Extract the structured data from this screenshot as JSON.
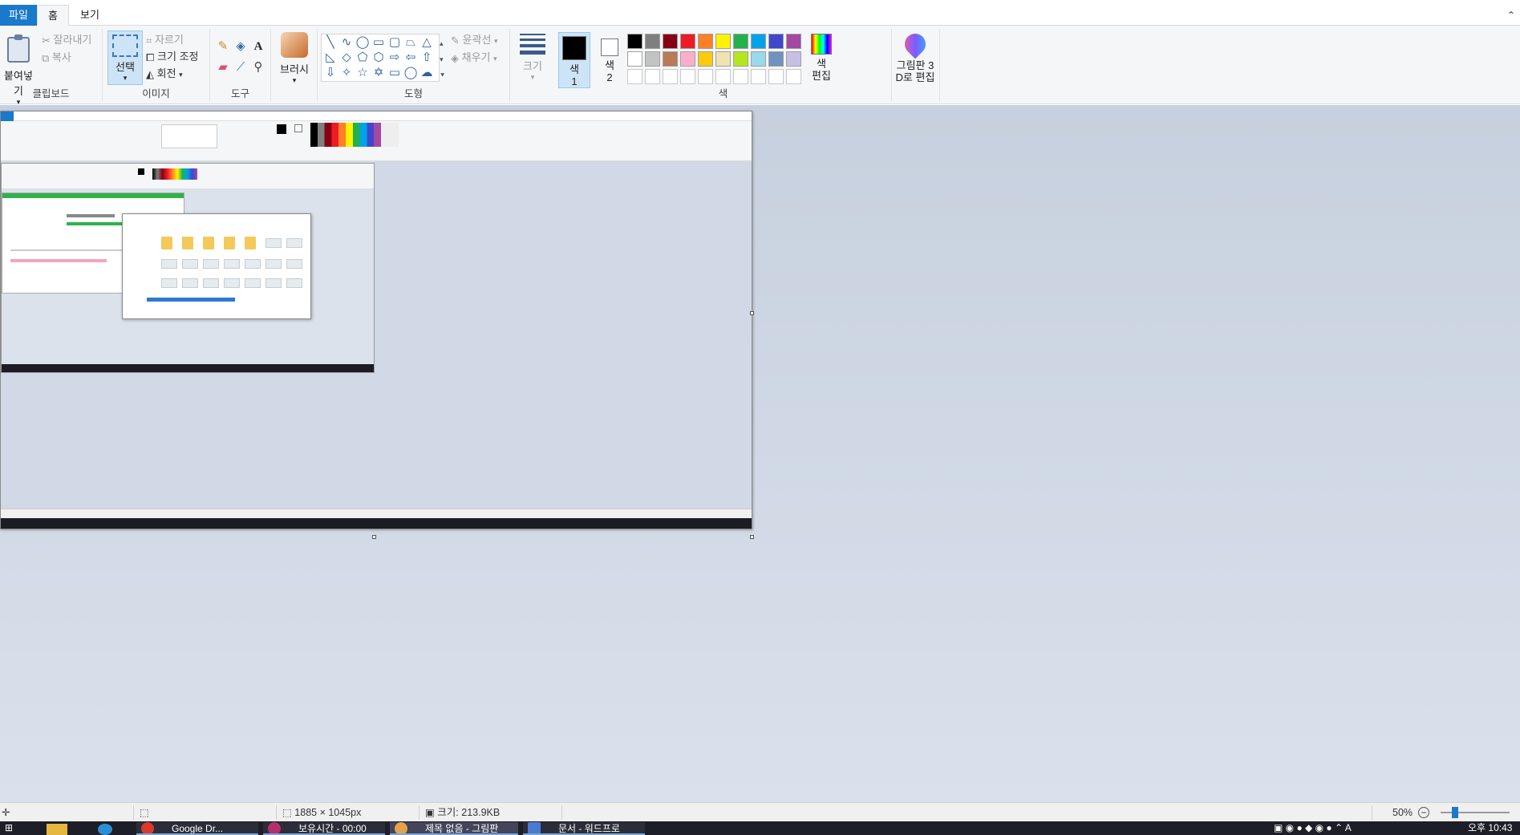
{
  "menu": {
    "tabs": [
      "파일",
      "홈",
      "보기"
    ]
  },
  "ribbon": {
    "clipboard": {
      "label": "클립보드",
      "paste": "붙여넣기",
      "cut": "잘라내기",
      "copy": "복사"
    },
    "image": {
      "label": "이미지",
      "select": "선택",
      "crop": "자르기",
      "resize": "크기 조정",
      "rotate": "회전"
    },
    "tools": {
      "label": "도구"
    },
    "brushes": {
      "label": "브러시"
    },
    "shapes": {
      "label": "도형",
      "outline": "윤곽선",
      "fill": "채우기"
    },
    "size": {
      "label": "크기"
    },
    "colors": {
      "label": "색",
      "color1_label": "색",
      "color1_num": "1",
      "color2_label": "색",
      "color2_num": "2",
      "color1_value": "#000000",
      "color2_value": "#ffffff",
      "edit_colors_line1": "색",
      "edit_colors_line2": "편집",
      "palette": [
        "#000000",
        "#7f7f7f",
        "#880015",
        "#ed1c24",
        "#ff7f27",
        "#fff200",
        "#22b14c",
        "#00a2e8",
        "#3f48cc",
        "#a349a4",
        "#ffffff",
        "#c3c3c3",
        "#b97a57",
        "#ffaec9",
        "#ffc90e",
        "#efe4b0",
        "#b5e61d",
        "#99d9ea",
        "#7092be",
        "#c8bfe7"
      ]
    },
    "paint3d": {
      "line1": "그림판 3",
      "line2": "D로 편집"
    }
  },
  "statusbar": {
    "dimensions": "1885 × 1045px",
    "filesize": "크기: 213.9KB",
    "zoom": "50%"
  },
  "taskbar": {
    "items": [
      "Google Dr...",
      "보유시간 - 00:00",
      "제목 없음 - 그림판",
      "문서 - 워드프로"
    ],
    "time_line1": "오후 10:43"
  }
}
